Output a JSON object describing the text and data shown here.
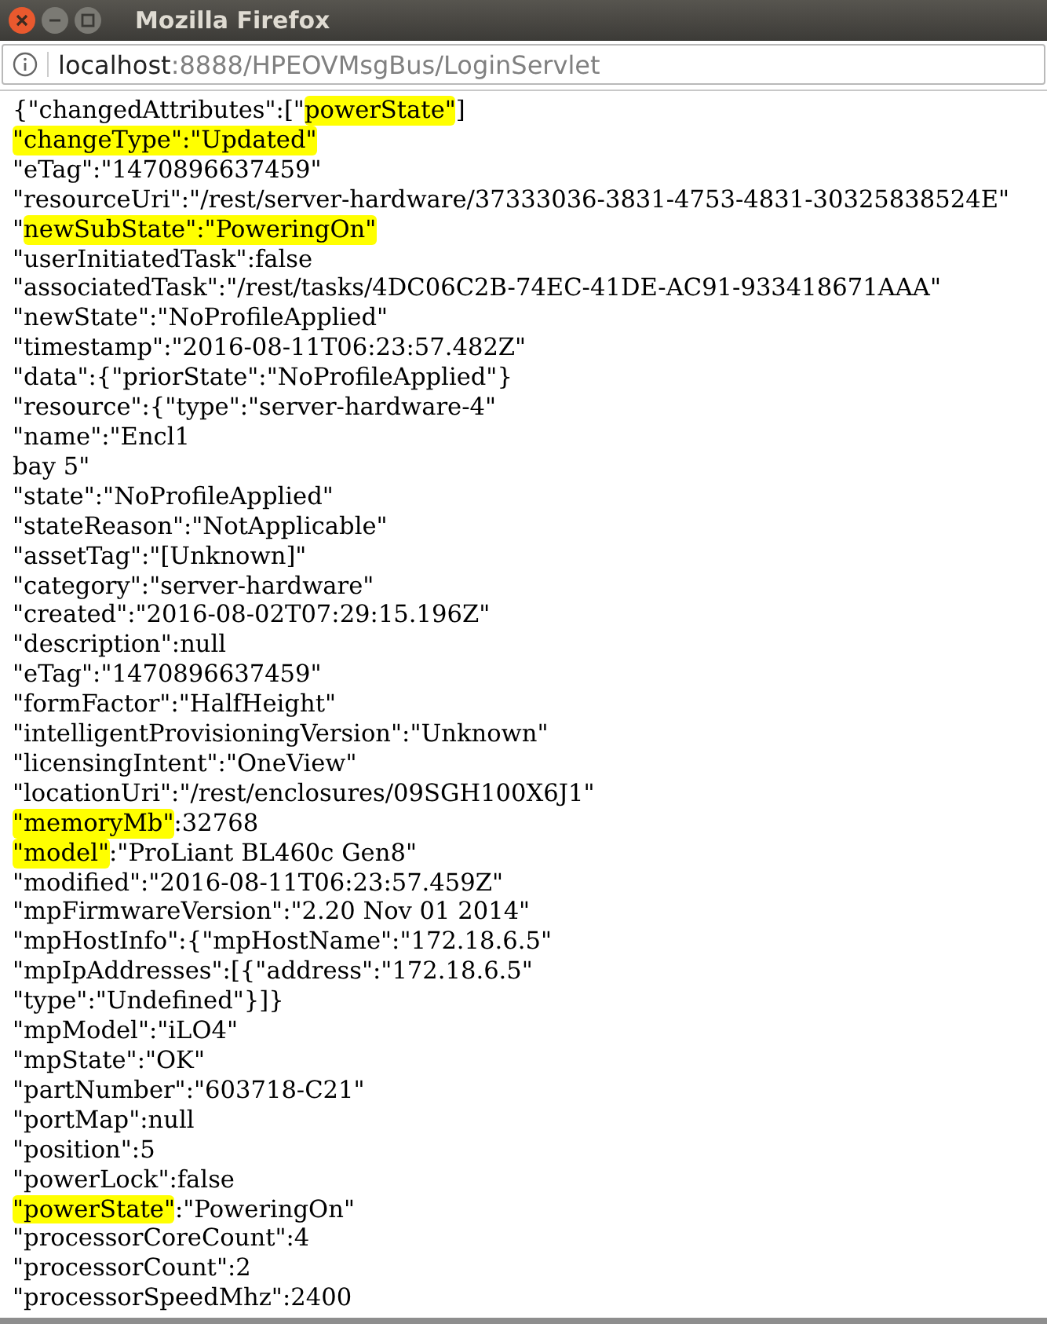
{
  "window": {
    "title": "Mozilla Firefox"
  },
  "address_bar": {
    "host": "localhost",
    "path": ":8888/HPEOVMsgBus/LoginServlet"
  },
  "lines": [
    [
      {
        "text": "{\"changedAttributes\":[\"",
        "highlighted": false
      },
      {
        "text": "powerState\"",
        "highlighted": true
      },
      {
        "text": "]",
        "highlighted": false
      }
    ],
    [
      {
        "text": "\"changeType\":\"Updated\"",
        "highlighted": true
      }
    ],
    [
      {
        "text": "\"eTag\":\"1470896637459\"",
        "highlighted": false
      }
    ],
    [
      {
        "text": "\"resourceUri\":\"/rest/server-hardware/37333036-3831-4753-4831-30325838524E\"",
        "highlighted": false
      }
    ],
    [
      {
        "text": "\"",
        "highlighted": false
      },
      {
        "text": "newSubState\":\"PoweringOn\"",
        "highlighted": true
      }
    ],
    [
      {
        "text": "\"userInitiatedTask\":false",
        "highlighted": false
      }
    ],
    [
      {
        "text": "\"associatedTask\":\"/rest/tasks/4DC06C2B-74EC-41DE-AC91-933418671AAA\"",
        "highlighted": false
      }
    ],
    [
      {
        "text": "\"newState\":\"NoProfileApplied\"",
        "highlighted": false
      }
    ],
    [
      {
        "text": "\"timestamp\":\"2016-08-11T06:23:57.482Z\"",
        "highlighted": false
      }
    ],
    [
      {
        "text": "\"data\":{\"priorState\":\"NoProfileApplied\"}",
        "highlighted": false
      }
    ],
    [
      {
        "text": "\"resource\":{\"type\":\"server-hardware-4\"",
        "highlighted": false
      }
    ],
    [
      {
        "text": "\"name\":\"Encl1",
        "highlighted": false
      }
    ],
    [
      {
        "text": "bay 5\"",
        "highlighted": false
      }
    ],
    [
      {
        "text": "\"state\":\"NoProfileApplied\"",
        "highlighted": false
      }
    ],
    [
      {
        "text": "\"stateReason\":\"NotApplicable\"",
        "highlighted": false
      }
    ],
    [
      {
        "text": "\"assetTag\":\"[Unknown]\"",
        "highlighted": false
      }
    ],
    [
      {
        "text": "\"category\":\"server-hardware\"",
        "highlighted": false
      }
    ],
    [
      {
        "text": "\"created\":\"2016-08-02T07:29:15.196Z\"",
        "highlighted": false
      }
    ],
    [
      {
        "text": "\"description\":null",
        "highlighted": false
      }
    ],
    [
      {
        "text": "\"eTag\":\"1470896637459\"",
        "highlighted": false
      }
    ],
    [
      {
        "text": "\"formFactor\":\"HalfHeight\"",
        "highlighted": false
      }
    ],
    [
      {
        "text": "\"intelligentProvisioningVersion\":\"Unknown\"",
        "highlighted": false
      }
    ],
    [
      {
        "text": "\"licensingIntent\":\"OneView\"",
        "highlighted": false
      }
    ],
    [
      {
        "text": "\"locationUri\":\"/rest/enclosures/09SGH100X6J1\"",
        "highlighted": false
      }
    ],
    [
      {
        "text": "\"memoryMb\"",
        "highlighted": true
      },
      {
        "text": ":32768",
        "highlighted": false
      }
    ],
    [
      {
        "text": "\"model\"",
        "highlighted": true
      },
      {
        "text": ":\"ProLiant BL460c Gen8\"",
        "highlighted": false
      }
    ],
    [
      {
        "text": "\"modified\":\"2016-08-11T06:23:57.459Z\"",
        "highlighted": false
      }
    ],
    [
      {
        "text": "\"mpFirmwareVersion\":\"2.20 Nov 01 2014\"",
        "highlighted": false
      }
    ],
    [
      {
        "text": "\"mpHostInfo\":{\"mpHostName\":\"172.18.6.5\"",
        "highlighted": false
      }
    ],
    [
      {
        "text": "\"mpIpAddresses\":[{\"address\":\"172.18.6.5\"",
        "highlighted": false
      }
    ],
    [
      {
        "text": "\"type\":\"Undefined\"}]}",
        "highlighted": false
      }
    ],
    [
      {
        "text": "\"mpModel\":\"iLO4\"",
        "highlighted": false
      }
    ],
    [
      {
        "text": "\"mpState\":\"OK\"",
        "highlighted": false
      }
    ],
    [
      {
        "text": "\"partNumber\":\"603718-C21\"",
        "highlighted": false
      }
    ],
    [
      {
        "text": "\"portMap\":null",
        "highlighted": false
      }
    ],
    [
      {
        "text": "\"position\":5",
        "highlighted": false
      }
    ],
    [
      {
        "text": "\"powerLock\":false",
        "highlighted": false
      }
    ],
    [
      {
        "text": "\"powerState\"",
        "highlighted": true
      },
      {
        "text": ":\"PoweringOn\"",
        "highlighted": false
      }
    ],
    [
      {
        "text": "\"processorCoreCount\":4",
        "highlighted": false
      }
    ],
    [
      {
        "text": "\"processorCount\":2",
        "highlighted": false
      }
    ],
    [
      {
        "text": "\"processorSpeedMhz\":2400",
        "highlighted": false
      }
    ]
  ]
}
